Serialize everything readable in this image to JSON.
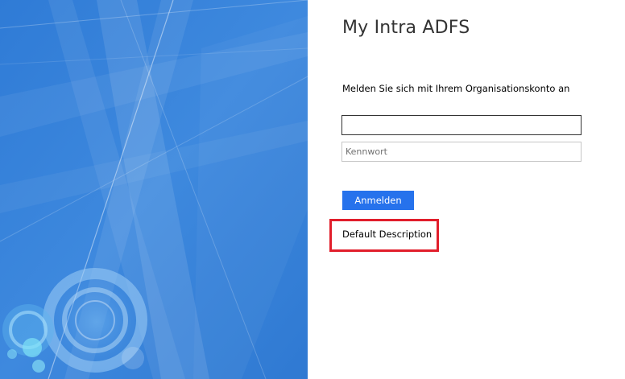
{
  "header": {
    "title": "My Intra ADFS"
  },
  "form": {
    "intro": "Melden Sie sich mit Ihrem Organisationskonto an",
    "username_value": "",
    "password_placeholder": "Kennwort",
    "submit_label": "Anmelden"
  },
  "description": {
    "text": "Default Description"
  },
  "colors": {
    "illustration_blue": "#3a85dc",
    "button_blue": "#2672ec",
    "highlight_red": "#e11e2b"
  },
  "icons": {
    "illustration": "abstract-blue-rings-graphic"
  }
}
